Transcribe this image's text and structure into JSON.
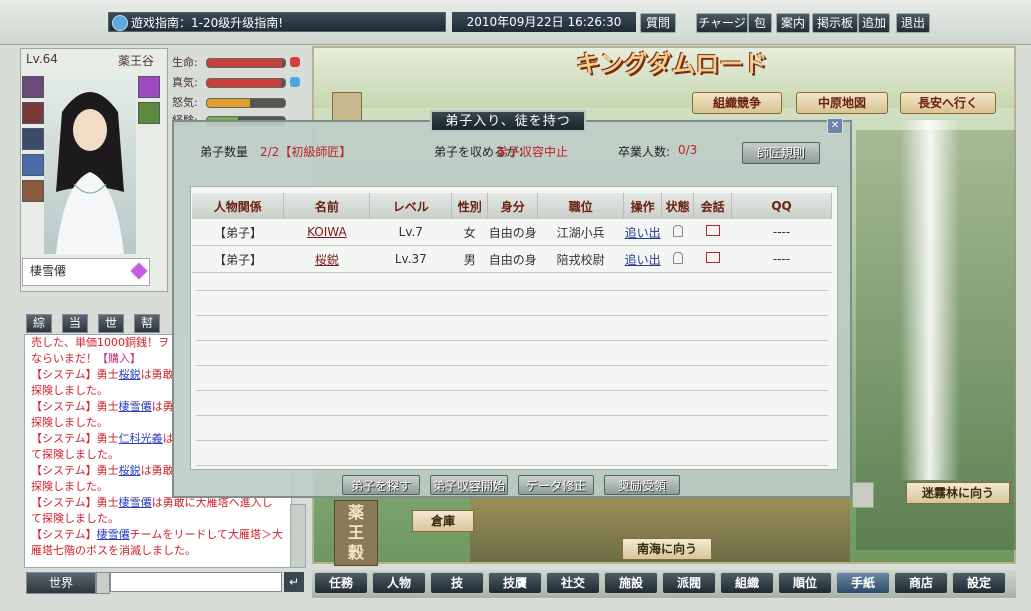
{
  "topbar": {
    "guide_text": "遊戏指南：1-20级升级指南!",
    "datetime": "2010年09月22日 16:26:30",
    "buttons": [
      "質問",
      "チャージ",
      "包",
      "案内",
      "掲示板",
      "追加",
      "退出"
    ]
  },
  "profile": {
    "level": "Lv.64",
    "guild": "薬王谷",
    "name": "棲雪僊",
    "stats": [
      {
        "label": "生命:",
        "fill": 0.96,
        "color": "#c84040"
      },
      {
        "label": "真気:",
        "fill": 0.95,
        "color": "#c84040"
      },
      {
        "label": "怒気:",
        "fill": 0.55,
        "color": "#e0a030"
      },
      {
        "label": "経験:",
        "fill": 0.4,
        "color": "#70b050"
      }
    ]
  },
  "chat": {
    "tabs": [
      "綜",
      "当",
      "世",
      "幇"
    ],
    "lines": [
      [
        {
          "t": "売した、単価1000銅銭！ヲ",
          "c": "sys"
        }
      ],
      [
        {
          "t": "ならいまだ！",
          "c": "sys"
        },
        {
          "t": "【購入】",
          "c": "lk"
        }
      ],
      [
        {
          "t": "【システム】勇士",
          "c": "sys"
        },
        {
          "t": "桜鋭",
          "c": "pn"
        },
        {
          "t": "は勇敢",
          "c": "sys"
        }
      ],
      [
        {
          "t": "探険しました。",
          "c": "sys"
        }
      ],
      [
        {
          "t": "【システム】勇士",
          "c": "sys"
        },
        {
          "t": "棲雪僊",
          "c": "pn"
        },
        {
          "t": "は勇",
          "c": "sys"
        }
      ],
      [
        {
          "t": "探険しました。",
          "c": "sys"
        }
      ],
      [
        {
          "t": "【システム】勇士",
          "c": "sys"
        },
        {
          "t": "仁科光義",
          "c": "pn"
        },
        {
          "t": "は",
          "c": "sys"
        }
      ],
      [
        {
          "t": "て探険しました。",
          "c": "sys"
        }
      ],
      [
        {
          "t": "【システム】勇士",
          "c": "sys"
        },
        {
          "t": "桜鋭",
          "c": "pn"
        },
        {
          "t": "は勇敢",
          "c": "sys"
        }
      ],
      [
        {
          "t": "探険しました。",
          "c": "sys"
        }
      ],
      [
        {
          "t": "【システム】勇士",
          "c": "sys"
        },
        {
          "t": "棲雪僊",
          "c": "pn"
        },
        {
          "t": "は勇敢に大雁塔へ進入し",
          "c": "sys"
        }
      ],
      [
        {
          "t": "て探険しました。",
          "c": "sys"
        }
      ],
      [
        {
          "t": "【システム】",
          "c": "sys"
        },
        {
          "t": "棲雪僊",
          "c": "pn"
        },
        {
          "t": "チームをリードして大雁塔＞大",
          "c": "sys"
        }
      ],
      [
        {
          "t": "雁塔七階のボスを消滅しました。",
          "c": "sys"
        }
      ]
    ],
    "channel": "世界",
    "send_icon": "enter-icon"
  },
  "game": {
    "logo": "キングダムロード",
    "nav": [
      "組織競争",
      "中原地図",
      "長安へ行く"
    ],
    "places": {
      "warehouse": "倉庫",
      "south": "南海に向う",
      "fog": "迷霧林に向う",
      "yaku": "薬王穀"
    }
  },
  "dialog": {
    "title": "弟子入り、徒を持つ",
    "close": "✕",
    "count_label": "弟子数量",
    "count_value": "2/2【初級師匠】",
    "recruit_label": "弟子を収めるか：",
    "recruit_value": "弟子収容中止",
    "grad_label": "卒業人数:",
    "grad_value": "0/3",
    "rule_btn": "師匠規則",
    "columns": [
      "人物関係",
      "名前",
      "レベル",
      "性別",
      "身分",
      "職位",
      "操作",
      "状態",
      "会話",
      "QQ"
    ],
    "rows": [
      {
        "rel": "【弟子】",
        "name": "KOIWA",
        "lv": "Lv.7",
        "sex": "女",
        "status": "自由の身",
        "post": "江湖小兵",
        "op": "追い出",
        "qq": "----"
      },
      {
        "rel": "【弟子】",
        "name": "桜鋭",
        "lv": "Lv.37",
        "sex": "男",
        "status": "自由の身",
        "post": "陪戎校尉",
        "op": "追い出",
        "qq": "----"
      }
    ],
    "buttons": [
      "弟子を探す",
      "弟子収容開始",
      "データ修正",
      "奨励受領"
    ]
  },
  "bottombar": [
    "任務",
    "人物",
    "技",
    "技贋",
    "社交",
    "施設",
    "派閥",
    "組織",
    "順位",
    "手紙",
    "商店",
    "設定"
  ],
  "bottombar_active": "手紙"
}
